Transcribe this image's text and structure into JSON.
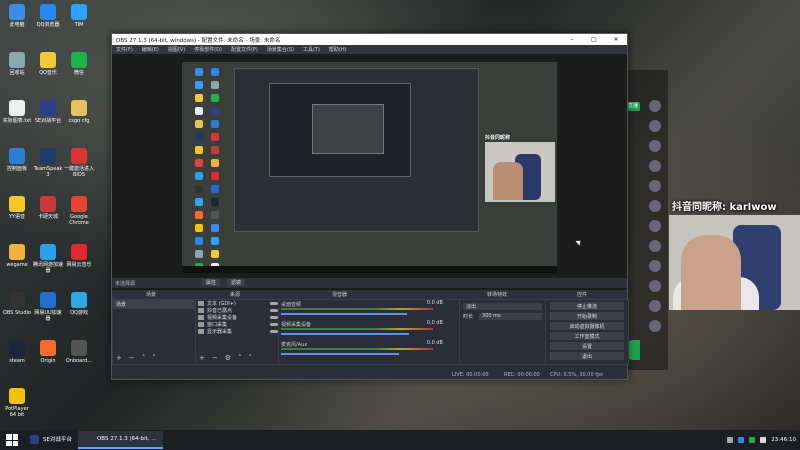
{
  "desktop": {
    "icons": [
      {
        "label": "此电脑",
        "color": "#3a8ee6"
      },
      {
        "label": "QQ浏览器",
        "color": "#2b86f0"
      },
      {
        "label": "TIM",
        "color": "#2fa0ff"
      },
      {
        "label": "回收站",
        "color": "#8aa"
      },
      {
        "label": "QQ音乐",
        "color": "#f3c93a"
      },
      {
        "label": "微信",
        "color": "#1fb24a"
      },
      {
        "label": "实际图表.txt",
        "color": "#eee"
      },
      {
        "label": "SE对战平台",
        "color": "#2c3e8c"
      },
      {
        "label": "csgo cfg",
        "color": "#e7c35b"
      },
      {
        "label": "控制面板",
        "color": "#2f7fd1"
      },
      {
        "label": "TeamSpeak 3",
        "color": "#1f3b6b"
      },
      {
        "label": "一键激活进入BIOS",
        "color": "#d33"
      },
      {
        "label": "YY语音",
        "color": "#f6c42b"
      },
      {
        "label": "卡硬天城",
        "color": "#c83a3a"
      },
      {
        "label": "Google Chrome",
        "color": "#e94235"
      },
      {
        "label": "wegame",
        "color": "#f2b33d"
      },
      {
        "label": "腾讯网游加速器",
        "color": "#2aa0ef"
      },
      {
        "label": "网易云音乐",
        "color": "#e12b2b"
      },
      {
        "label": "OBS Studio",
        "color": "#333"
      },
      {
        "label": "网易UU加速器",
        "color": "#1f6ed4"
      },
      {
        "label": "QQ游戏",
        "color": "#2ea6e8"
      },
      {
        "label": "steam",
        "color": "#1b2838"
      },
      {
        "label": "Origin",
        "color": "#f56c2d"
      },
      {
        "label": "Onboard...",
        "color": "#555"
      },
      {
        "label": "PotPlayer 64 bit",
        "color": "#f4c400"
      }
    ]
  },
  "taskbar": {
    "items": [
      {
        "label": "SE对战平台",
        "color": "#2c3e8c",
        "active": false
      },
      {
        "label": "OBS 27.1.3 (64-bit, ...",
        "color": "#333",
        "active": true
      }
    ],
    "time": "23:46:10"
  },
  "obs": {
    "title": "OBS 27.1.3 (64-bit, windows) - 配置文件: 未命名 - 场景: 未命名",
    "window_controls": [
      "–",
      "□",
      "✕"
    ],
    "menu": [
      "文件(F)",
      "编辑(E)",
      "视图(V)",
      "停靠部件(D)",
      "配置文件(P)",
      "场景集合(S)",
      "工具(T)",
      "帮助(H)"
    ],
    "source_toolbar": {
      "props": "属性",
      "filters": "滤镜"
    },
    "no_source": "未选择源",
    "docks": {
      "scenes": {
        "title": "场景",
        "items": [
          "场景"
        ]
      },
      "sources": {
        "title": "来源",
        "items": [
          {
            "name": "文本 (GDI+)",
            "icon": "text-icon"
          },
          {
            "name": "抖音已露点",
            "icon": "text-icon"
          },
          {
            "name": "视频采集设备",
            "icon": "camera-icon"
          },
          {
            "name": "窗口采集",
            "icon": "window-icon"
          },
          {
            "name": "显示器采集",
            "icon": "monitor-icon"
          }
        ]
      },
      "mixer": {
        "title": "混音器",
        "tracks": [
          {
            "name": "桌面音频",
            "db": "0.0 dB",
            "level": 0.78
          },
          {
            "name": "视频采集设备",
            "db": "0.0 dB",
            "level": 0.8
          },
          {
            "name": "麦克风/Aux",
            "db": "0.0 dB",
            "level": 0.72
          }
        ]
      },
      "transitions": {
        "title": "转场特效",
        "type": "淡出",
        "duration_label": "时长",
        "duration_value": "300 ms"
      },
      "controls": {
        "title": "控件",
        "buttons": [
          "停止推流",
          "开始录制",
          "启动虚拟摄像机",
          "工作室模式",
          "设置",
          "退出"
        ]
      }
    },
    "status": {
      "live": "LIVE: 00:00:00",
      "rec": "REC: 00:00:00",
      "cpu": "CPU: 0.5%, 30.00 fps"
    }
  },
  "stream_overlay": {
    "caption": "抖音同昵称: karlwow",
    "thumb_caption": "抖音同昵称",
    "green_label": "直播"
  }
}
